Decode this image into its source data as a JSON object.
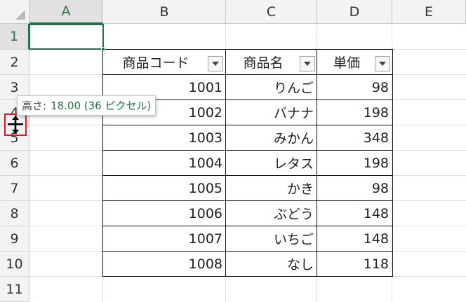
{
  "columns": [
    "A",
    "B",
    "C",
    "D",
    "E"
  ],
  "rows": [
    "1",
    "2",
    "3",
    "4",
    "5",
    "6",
    "7",
    "8",
    "9",
    "10",
    "11"
  ],
  "table": {
    "headers": [
      "商品コード",
      "商品名",
      "単価"
    ],
    "records": [
      [
        "1001",
        "りんご",
        "98"
      ],
      [
        "1002",
        "バナナ",
        "198"
      ],
      [
        "1003",
        "みかん",
        "348"
      ],
      [
        "1004",
        "レタス",
        "198"
      ],
      [
        "1005",
        "かき",
        "98"
      ],
      [
        "1006",
        "ぶどう",
        "148"
      ],
      [
        "1007",
        "いちご",
        "148"
      ],
      [
        "1008",
        "なし",
        "118"
      ]
    ]
  },
  "tooltip": {
    "label": "高さ:",
    "value": "18.00 (36 ピクセル)"
  },
  "colors": {
    "accent": "#217346",
    "highlight": "#e81123"
  },
  "icons": {
    "filter": "filter-dropdown-icon",
    "cursor": "row-resize-cursor-icon"
  }
}
